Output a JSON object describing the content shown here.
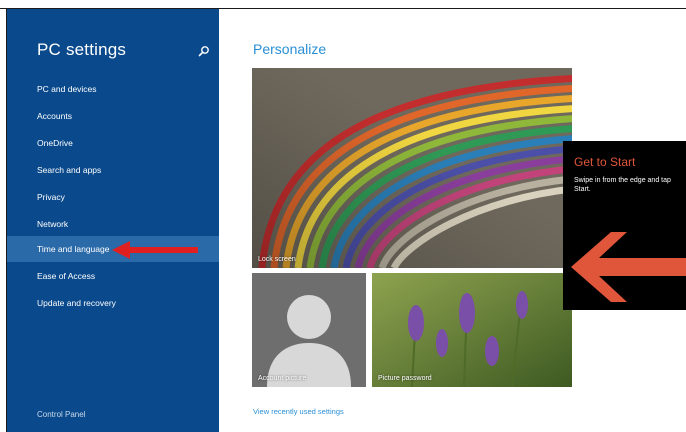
{
  "sidebar": {
    "title": "PC settings",
    "items": [
      {
        "label": "PC and devices"
      },
      {
        "label": "Accounts"
      },
      {
        "label": "OneDrive"
      },
      {
        "label": "Search and apps"
      },
      {
        "label": "Privacy"
      },
      {
        "label": "Network"
      },
      {
        "label": "Time and language"
      },
      {
        "label": "Ease of Access"
      },
      {
        "label": "Update and recovery"
      }
    ],
    "selected_label": "Time and language",
    "footer_link": "Control Panel"
  },
  "content": {
    "title": "Personalize",
    "tiles": {
      "lock_screen": "Lock screen",
      "account_picture": "Account picture",
      "picture_password": "Picture password"
    },
    "recent_link": "View recently used settings"
  },
  "tip": {
    "title": "Get to Start",
    "body": "Swipe in from the edge and tap Start."
  },
  "icons": {
    "search": "search-icon",
    "annotation_arrow": "red-arrow-icon",
    "tip_arrow": "left-arrow-icon"
  },
  "colors": {
    "sidebar_bg": "#0a4a8c",
    "selected_bg": "#2b6aa8",
    "accent": "#2a8fd4",
    "tip_title": "#e0563b",
    "annotation": "#e02020"
  }
}
